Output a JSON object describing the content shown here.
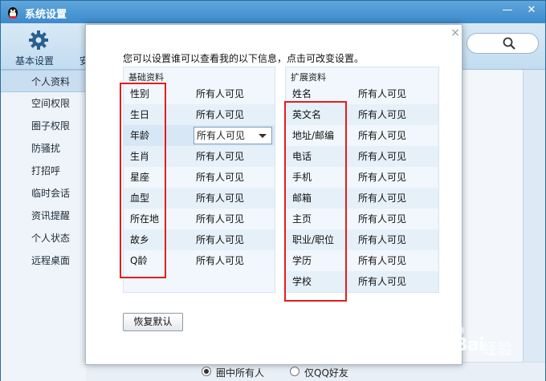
{
  "window": {
    "title": "系统设置",
    "minimize_label": "—",
    "close_label": "✕"
  },
  "toolbar": {
    "basic_settings_label": "基本设置",
    "edge_label": "安"
  },
  "sidebar": {
    "items": [
      {
        "label": "个人资料",
        "active": true
      },
      {
        "label": "空间权限"
      },
      {
        "label": "圈子权限"
      },
      {
        "label": "防骚扰"
      },
      {
        "label": "打招呼"
      },
      {
        "label": "临时会话"
      },
      {
        "label": "资讯提醒"
      },
      {
        "label": "个人状态"
      },
      {
        "label": "远程桌面"
      }
    ]
  },
  "dialog": {
    "close_label": "×",
    "description": "您可以设置谁可以查看我的以下信息，点击可改变设置。",
    "basic_panel": {
      "heading": "基础资料",
      "rows": [
        {
          "field": "性别",
          "value": "所有人可见"
        },
        {
          "field": "生日",
          "value": "所有人可见"
        },
        {
          "field": "年龄",
          "value": "所有人可见",
          "dropdown": true
        },
        {
          "field": "生肖",
          "value": "所有人可见"
        },
        {
          "field": "星座",
          "value": "所有人可见"
        },
        {
          "field": "血型",
          "value": "所有人可见"
        },
        {
          "field": "所在地",
          "value": "所有人可见"
        },
        {
          "field": "故乡",
          "value": "所有人可见"
        },
        {
          "field": "Q龄",
          "value": "所有人可见"
        }
      ]
    },
    "extended_panel": {
      "heading": "扩展资料",
      "rows": [
        {
          "field": "姓名",
          "value": "所有人可见"
        },
        {
          "field": "英文名",
          "value": "所有人可见"
        },
        {
          "field": "地址/邮编",
          "value": "所有人可见"
        },
        {
          "field": "电话",
          "value": "所有人可见"
        },
        {
          "field": "手机",
          "value": "所有人可见"
        },
        {
          "field": "邮箱",
          "value": "所有人可见"
        },
        {
          "field": "主页",
          "value": "所有人可见"
        },
        {
          "field": "职业/职位",
          "value": "所有人可见"
        },
        {
          "field": "学历",
          "value": "所有人可见"
        },
        {
          "field": "学校",
          "value": "所有人可见"
        }
      ]
    },
    "restore_button": "恢复默认"
  },
  "bottom": {
    "radio_options": [
      {
        "label": "圈中所有人",
        "checked": true
      },
      {
        "label": "仅QQ好友",
        "checked": false
      }
    ]
  },
  "watermark": {
    "brand": "Bai",
    "cn": "经验"
  },
  "colors": {
    "highlight_box": "#e21e1e",
    "titlebar": "#3c8acb"
  }
}
